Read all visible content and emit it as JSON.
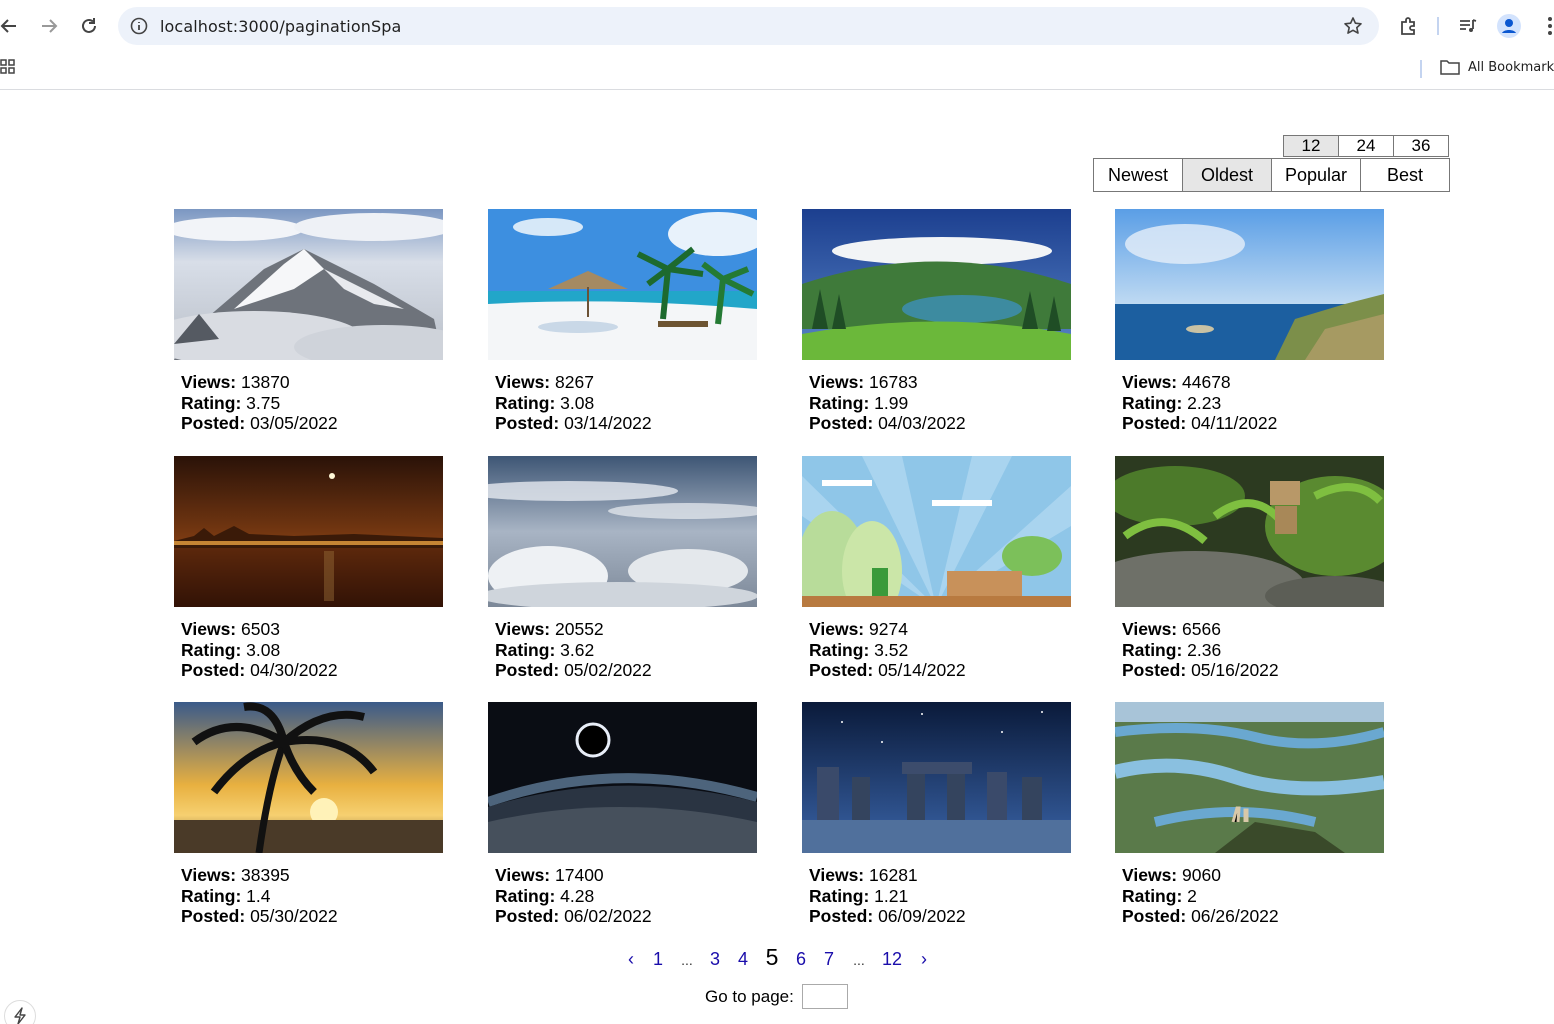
{
  "browser": {
    "url": "localhost:3000/paginationSpa",
    "all_bookmarks_label": "All Bookmarks"
  },
  "page_size": {
    "options": [
      "12",
      "24",
      "36"
    ],
    "selected": "12"
  },
  "sort": {
    "options": [
      "Newest",
      "Oldest",
      "Popular",
      "Best"
    ],
    "selected": "Oldest"
  },
  "labels": {
    "views": "Views:",
    "rating": "Rating:",
    "posted": "Posted:"
  },
  "items": [
    {
      "views": "13870",
      "rating": "3.75",
      "posted": "03/05/2022",
      "image": "snowy-mountain-peaks"
    },
    {
      "views": "8267",
      "rating": "3.08",
      "posted": "03/14/2022",
      "image": "tropical-beach-umbrella"
    },
    {
      "views": "16783",
      "rating": "1.99",
      "posted": "04/03/2022",
      "image": "green-valley-lake"
    },
    {
      "views": "44678",
      "rating": "2.23",
      "posted": "04/11/2022",
      "image": "ocean-coastline"
    },
    {
      "views": "6503",
      "rating": "3.08",
      "posted": "04/30/2022",
      "image": "city-night-moon"
    },
    {
      "views": "20552",
      "rating": "3.62",
      "posted": "05/02/2022",
      "image": "clouds-sky"
    },
    {
      "views": "9274",
      "rating": "3.52",
      "posted": "05/14/2022",
      "image": "retro-game-landscape"
    },
    {
      "views": "6566",
      "rating": "2.36",
      "posted": "05/16/2022",
      "image": "danbo-in-plants"
    },
    {
      "views": "38395",
      "rating": "1.4",
      "posted": "05/30/2022",
      "image": "palm-tree-sunset"
    },
    {
      "views": "17400",
      "rating": "4.28",
      "posted": "06/02/2022",
      "image": "eclipse-over-earth"
    },
    {
      "views": "16281",
      "rating": "1.21",
      "posted": "06/09/2022",
      "image": "stonehenge-night"
    },
    {
      "views": "9060",
      "rating": "2",
      "posted": "06/26/2022",
      "image": "river-valley-deer"
    }
  ],
  "pagination": {
    "prev": "‹",
    "next": "›",
    "items": [
      "1",
      "...",
      "3",
      "4",
      "5",
      "6",
      "7",
      "...",
      "12"
    ],
    "current": "5"
  },
  "goto": {
    "label": "Go to page:",
    "value": ""
  }
}
